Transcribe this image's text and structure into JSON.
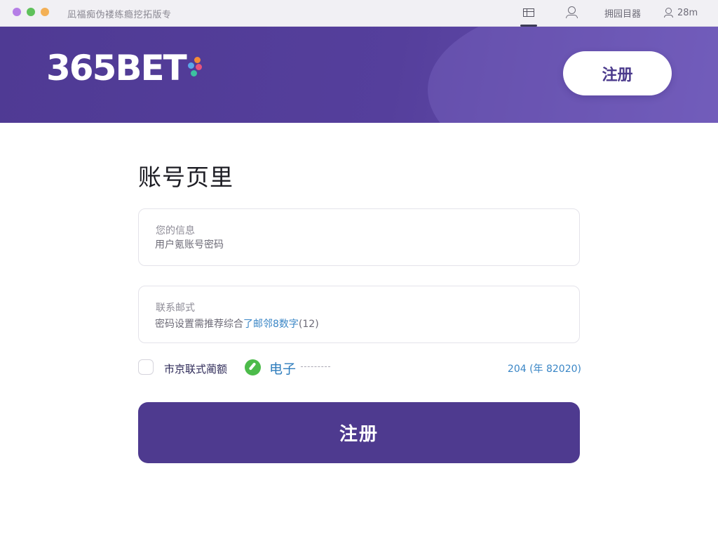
{
  "window": {
    "title": "凪福痴伪褛练瘾挖拓版专",
    "traffic_lights": [
      "#b57ee6",
      "#5fc15b",
      "#f3b056"
    ],
    "toolbar": [
      {
        "icon": "grid-icon",
        "label": "",
        "active": true
      },
      {
        "icon": "user-icon",
        "label": "",
        "active": false
      },
      {
        "icon": "",
        "label": "拥园目器",
        "active": false
      },
      {
        "icon": "user-icon",
        "label": "28m",
        "active": false
      }
    ]
  },
  "header": {
    "logo_text": "365BET",
    "logo_dot_colors": [
      "#f58b36",
      "#5ba8e8",
      "#e8547c",
      "#3cc2a0"
    ],
    "signup_label": "注册"
  },
  "form": {
    "title": "账号页里",
    "account": {
      "label": "您的信息",
      "placeholder": "用户氪账号密码"
    },
    "contact": {
      "label": "联系邮式",
      "hint_plain": "密码设置需推荐综合",
      "hint_accent": "了邮邻8数字",
      "hint_tail": "(12)"
    },
    "options": {
      "checkbox_label": "市京联式蔺额",
      "status_label": "电子",
      "right_text": "204 (年 82020)"
    },
    "submit_label": "注册"
  },
  "colors": {
    "brand_purple": "#4e3a8f",
    "accent_blue": "#3a86c6",
    "success_green": "#4cbb4a"
  }
}
